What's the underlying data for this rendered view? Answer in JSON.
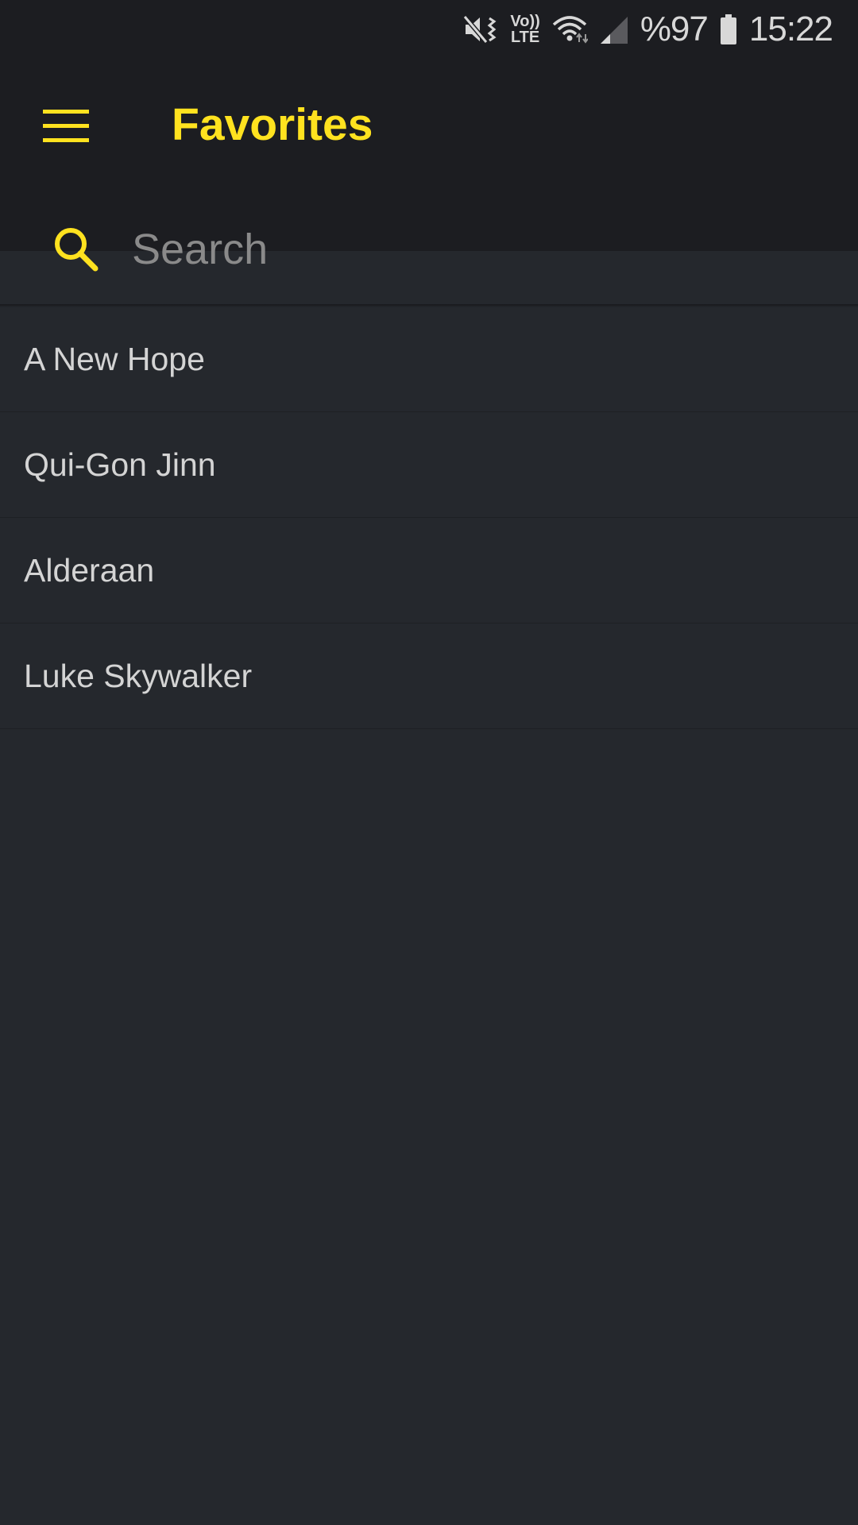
{
  "status_bar": {
    "battery_text": "%97",
    "time": "15:22",
    "network_badge_top": "Vo))",
    "network_badge_bottom": "LTE",
    "icons": [
      "mute-vibrate-icon",
      "volte-icon",
      "wifi-icon",
      "signal-icon",
      "battery-icon"
    ]
  },
  "app_bar": {
    "title": "Favorites",
    "menu_icon": "hamburger-menu-icon"
  },
  "search": {
    "placeholder": "Search",
    "value": "",
    "icon": "search-icon"
  },
  "favorites": [
    {
      "label": "A New Hope"
    },
    {
      "label": "Qui-Gon Jinn"
    },
    {
      "label": "Alderaan"
    },
    {
      "label": "Luke Skywalker"
    }
  ],
  "colors": {
    "accent": "#ffe21f",
    "app_bar_bg": "#1c1d21",
    "list_bg": "#25282d",
    "text": "#d4d4d4",
    "placeholder": "#8a8a8a"
  }
}
